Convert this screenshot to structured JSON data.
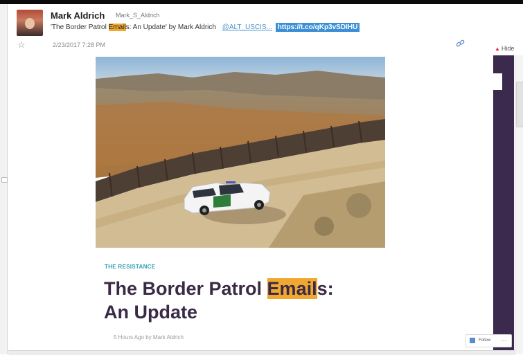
{
  "tweet": {
    "display_name": "Mark Aldrich",
    "handle": "Mark_S_Aldrich",
    "text_before": "'The Border Patrol ",
    "highlight": "Email",
    "text_after": "s: An Update' by Mark Aldrich",
    "mention": "@ALT_USCIS...",
    "url": "https://t.co/qKp3vSDIHU",
    "timestamp": "2/23/2017 7:28 PM",
    "hide_label": "Hide"
  },
  "article": {
    "kicker": "THE RESISTANCE",
    "title_part1": "The Border Patrol ",
    "title_highlight": "Email",
    "title_part2": "s:",
    "title_line2": "An Update",
    "byline": "5 Hours Ago by Mark Aldrich"
  },
  "follow": {
    "label": "Follow",
    "more": "…"
  },
  "colors": {
    "highlight": "#f0a830",
    "url_chip": "#3c8fd6",
    "purple_panel": "#3b2a4e",
    "kicker": "#33a0b5"
  },
  "icons": [
    "star-icon",
    "link-icon",
    "hide-triangle-icon",
    "follow-icon",
    "more-icon"
  ]
}
